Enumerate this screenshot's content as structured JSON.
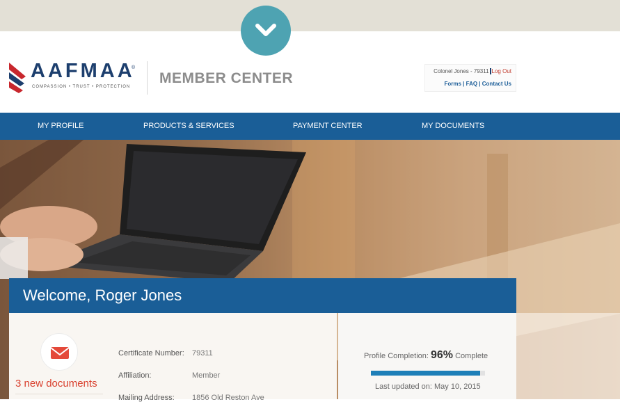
{
  "brand": {
    "name": "AAFMAA",
    "tagline": "COMPASSION • TRUST • PROTECTION",
    "registered": "®",
    "section": "MEMBER CENTER",
    "colors": {
      "navy": "#1d3f6e",
      "nav_blue": "#1a5e97",
      "teal": "#4ea3b2",
      "accent_red": "#d9412f"
    }
  },
  "topbar": {
    "toggle_icon": "chevron-down-icon"
  },
  "account": {
    "user": "Colonel Jones - 79311",
    "logout": "Log Out",
    "links": "Forms | FAQ | Contact Us"
  },
  "nav": {
    "items": [
      {
        "label": "MY PROFILE"
      },
      {
        "label": "PRODUCTS & SERVICES"
      },
      {
        "label": "PAYMENT CENTER"
      },
      {
        "label": "MY DOCUMENTS"
      }
    ]
  },
  "welcome": {
    "text": "Welcome, Roger Jones"
  },
  "documents": {
    "icon": "mail-icon",
    "label": "3 new documents"
  },
  "member_info": {
    "fields": [
      {
        "label": "Certificate Number:",
        "value": "79311"
      },
      {
        "label": "Affiliation:",
        "value": "Member"
      },
      {
        "label": "Mailing Address:",
        "value": "1856 Old Reston Ave"
      }
    ]
  },
  "profile": {
    "completion_prefix": "Profile Completion:",
    "completion_value": "96%",
    "completion_suffix": "Complete",
    "progress_percent": 96,
    "last_updated": "Last updated on: May 10, 2015"
  }
}
